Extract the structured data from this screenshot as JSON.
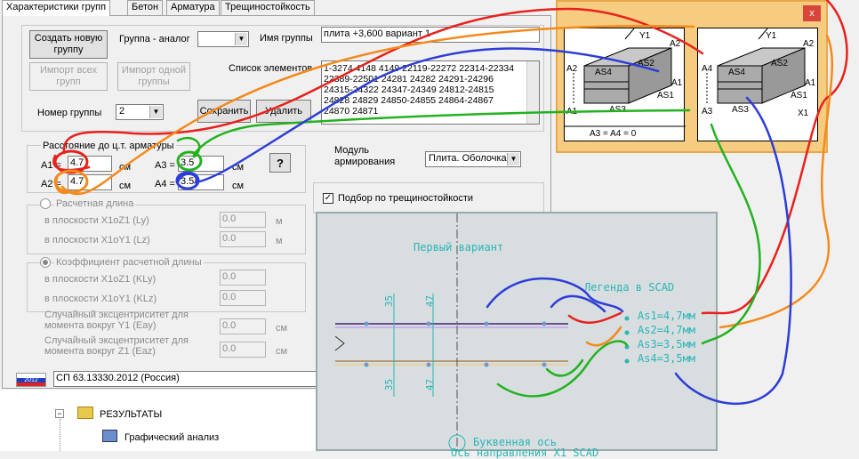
{
  "tabs": [
    "Характеристики групп",
    "Бетон",
    "Арматура",
    "Трещиностойкость"
  ],
  "buttons": {
    "create_group": "Создать новую группу",
    "import_all": "Импорт всех групп",
    "import_one": "Импорт одной группы",
    "save": "Сохранить",
    "delete": "Удалить",
    "help": "?"
  },
  "group_analog_label": "Группа - аналог",
  "group_name_label": "Имя группы",
  "group_name_value": "плита +3,600 вариант 1",
  "element_list_label": "Список элементов",
  "element_list": [
    "1-3274 4148 4149 22119-22272 22314-22334",
    "22389-22501 24281 24282 24291-24296",
    "24315-24322 24347-24349 24812-24815",
    "24828 24829 24850-24855 24864-24867",
    "24870 24871"
  ],
  "group_number_label": "Номер группы",
  "group_number_value": "2",
  "distance_group_label": "Расстояние до ц.т. арматуры",
  "a1_label": "A1 =",
  "a1_value": "4.7",
  "a2_label": "A2 =",
  "a2_value": "4.7",
  "a3_label": "A3 =",
  "a3_value": "3.5",
  "a4_label": "A4 =",
  "a4_value": "3.5",
  "unit_cm": "см",
  "unit_m": "м",
  "modulus_label": "Модуль армирования",
  "modulus_value": "Плита. Оболочка",
  "crack_check_label": "Подбор по трещиностойкости",
  "design_length_label": "Расчетная длина",
  "plane_x1z1_ly": "в плоскости X1oZ1 (Ly)",
  "plane_x1y1_lz": "в плоскости X1oY1 (Lz)",
  "coef_label": "Коэффициент расчетной длины",
  "plane_x1z1_kly": "в плоскости X1oZ1 (KLy)",
  "plane_x1y1_klz": "в плоскости X1oY1 (KLz)",
  "ecc_y1": "Случайный эксцентриситет для момента вокруг Y1 (Eay)",
  "ecc_z1": "Случайный эксцентриситет для момента вокруг Z1 (Eaz)",
  "zero": "0.0",
  "norm_badge": "2012",
  "norm_value": "СП 63.13330.2012 (Россия)",
  "tree_results": "РЕЗУЛЬТАТЫ",
  "tree_graphic": "Графический анализ",
  "cad": {
    "title": "Первый вариант",
    "legend_title": "Легенда в SCAD",
    "as1": "As1=4,7мм",
    "as2": "As2=4,7мм",
    "as3": "As3=3,5мм",
    "as4": "As4=3,5мм",
    "dim35": "35",
    "dim47": "47",
    "axis_label": "Буквенная ось",
    "axis_label2": "Ось направления X1 SCAD"
  },
  "scheme": {
    "close": "x",
    "y1": "Y1",
    "a2": "A2",
    "as4": "AS4",
    "as2": "AS2",
    "a1": "A1",
    "as1": "AS1",
    "as3": "AS3",
    "a3": "A3",
    "a4": "A4",
    "x1": "X1",
    "eq": "A3 = A4 = 0"
  },
  "colors": {
    "red": "#e8211c",
    "orange": "#f38a1c",
    "green": "#22b21e",
    "blue": "#2d3dd6",
    "cad_cyan": "#2bb5b5"
  }
}
